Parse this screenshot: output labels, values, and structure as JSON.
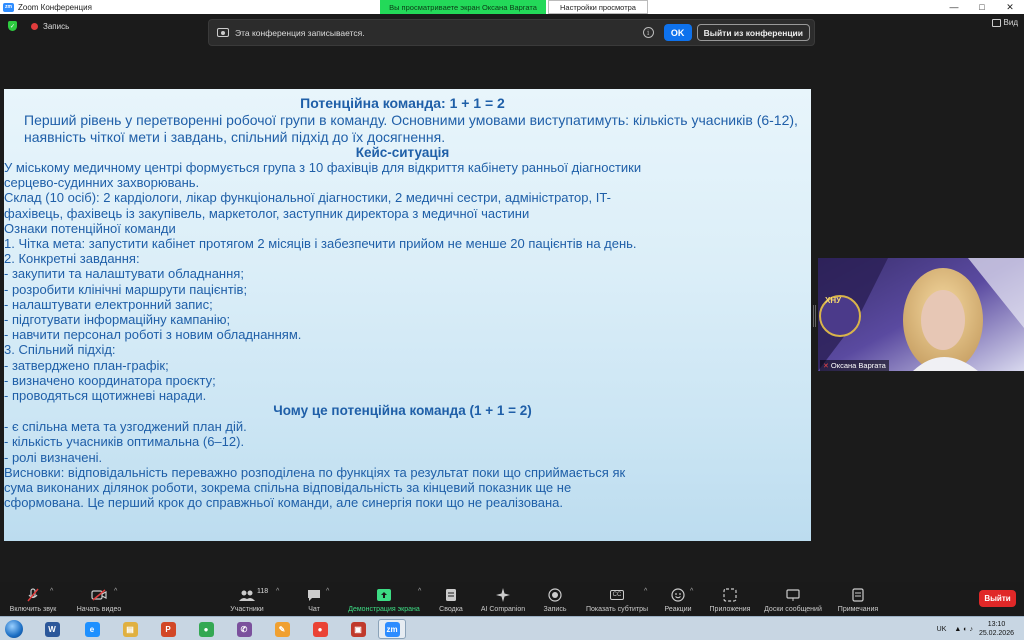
{
  "window": {
    "title": "Zoom Конференция",
    "logo_text": "zm",
    "share_banner": "Вы просматриваете экран Оксана Варгата",
    "view_options": "Настройки просмотра",
    "controls": [
      "—",
      "□",
      "✕"
    ]
  },
  "status": {
    "recording_label": "Запись",
    "view_label": "Вид"
  },
  "notice": {
    "text": "Эта конференция записывается.",
    "info_glyph": "i",
    "ok_label": "OK",
    "leave_label": "Выйти из конференции"
  },
  "slide": {
    "title": "Потенційна команда: 1 + 1 = 2",
    "lead": "Перший рівень у перетворенні робочої групи в команду. Основними умовами виступатимуть: кількість учасників (6-12), наявність чіткої мети і завдань, спільний підхід до їх досягнення.",
    "case_title": "Кейс-ситуація",
    "lines_a": [
      "У міському медичному центрі формується група з 10 фахівців для відкриття кабінету ранньої діагностики",
      "серцево-судинних захворювань.",
      "Склад (10 осіб): 2 кардіологи, лікар функціональної діагностики, 2 медичні сестри, адміністратор, IT-",
      "фахівець, фахівець із закупівель, маркетолог, заступник директора з медичної частини",
      "Ознаки потенційної команди",
      "1. Чітка мета: запустити кабінет протягом 2 місяців і забезпечити прийом не менше 20 пацієнтів на день.",
      "2. Конкретні завдання:",
      "- закупити та налаштувати обладнання;",
      "- розробити клінічні маршрути пацієнтів;",
      "- налаштувати електронний запис;",
      "- підготувати інформаційну кампанію;",
      "- навчити персонал роботі з новим обладнанням.",
      "3. Спільний підхід:",
      "- затверджено план-графік;",
      "- визначено координатора проєкту;",
      "-   проводяться щотижневі наради."
    ],
    "why_title": "Чому це потенційна команда (1 + 1 = 2)",
    "lines_b": [
      "- є спільна мета та узгоджений план дій.",
      "- кількість учасників оптимальна (6–12).",
      "-   ролі визначені.",
      "Висновки:  відповідальність переважно розподілена по функціях та  результат поки що сприймається як",
      "сума виконаних ділянок роботи, зокрема  спільна відповідальність за кінцевий показник ще не",
      "сформована. Це перший крок до справжньої команди, але синергія поки що не реалізована."
    ]
  },
  "video": {
    "participant_name": "Оксана Варгата",
    "logo_text": "ХНУ"
  },
  "toolbar": {
    "mute": "Включить звук",
    "video": "Начать видео",
    "participants": "Участники",
    "participants_count": "118",
    "chat": "Чат",
    "share": "Демонстрация экрана",
    "summary": "Сводка",
    "companion": "AI Companion",
    "record": "Запись",
    "captions": "Показать субтитры",
    "captions_glyph": "CC",
    "reactions": "Реакции",
    "apps": "Приложения",
    "whiteboards": "Доски сообщений",
    "notes": "Примечания",
    "end": "Выйти"
  },
  "taskbar": {
    "apps": [
      {
        "name": "word",
        "glyph": "W",
        "color": "#2b579a"
      },
      {
        "name": "ie",
        "glyph": "e",
        "color": "#1e90ff"
      },
      {
        "name": "explorer",
        "glyph": "▤",
        "color": "#e0b040"
      },
      {
        "name": "powerpoint",
        "glyph": "P",
        "color": "#d24726"
      },
      {
        "name": "chrome",
        "glyph": "●",
        "color": "#34a853"
      },
      {
        "name": "viber",
        "glyph": "✆",
        "color": "#7b519d"
      },
      {
        "name": "paint",
        "glyph": "✎",
        "color": "#f0a030"
      },
      {
        "name": "chrome-2",
        "glyph": "●",
        "color": "#ea4335"
      },
      {
        "name": "viewer",
        "glyph": "▣",
        "color": "#c0392b"
      },
      {
        "name": "zoom",
        "glyph": "zm",
        "color": "#2d8cff"
      }
    ],
    "lang": "UK",
    "time": "13:10",
    "date": "25.02.2026"
  },
  "colors": {
    "slide_text": "#1f5fa8",
    "share_green": "#23d959",
    "zoom_blue": "#0e72ed",
    "end_red": "#e02828"
  }
}
